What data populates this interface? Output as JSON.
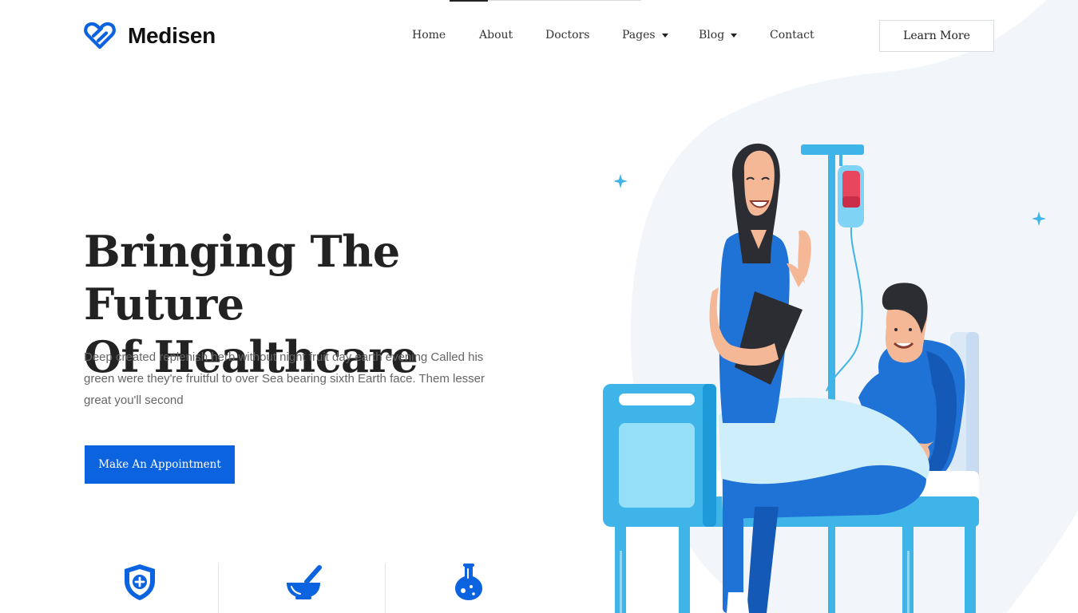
{
  "brand": {
    "name": "Medisen",
    "logo_icon": "heart-link-icon",
    "accent": "#0c63df"
  },
  "nav": {
    "items": [
      {
        "label": "Home"
      },
      {
        "label": "About"
      },
      {
        "label": "Doctors"
      },
      {
        "label": "Pages",
        "dropdown": true
      },
      {
        "label": "Blog",
        "dropdown": true
      },
      {
        "label": "Contact"
      }
    ],
    "cta_label": "Learn More"
  },
  "hero": {
    "title_line1": "Bringing The Future",
    "title_line2": "Of Healthcare",
    "description": "Deep created replenish herb without night fruit day earth evening Called his green were they're fruitful to over Sea bearing sixth Earth face. Them lesser great you'll second",
    "button_label": "Make An Appointment",
    "illustration": "nurse-and-patient-in-hospital-bed"
  },
  "features": [
    {
      "icon": "shield-plus-icon"
    },
    {
      "icon": "mortar-pestle-icon"
    },
    {
      "icon": "flask-icon"
    }
  ]
}
